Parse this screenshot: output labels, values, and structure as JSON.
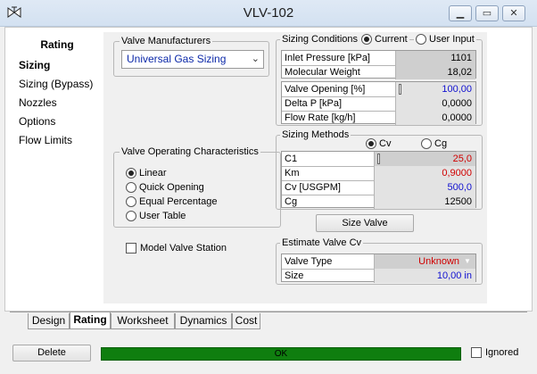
{
  "window": {
    "title": "VLV-102",
    "minimize_glyph": "▁",
    "restore_glyph": "▭",
    "close_glyph": "✕"
  },
  "nav": {
    "heading": "Rating",
    "items": [
      {
        "label": "Sizing"
      },
      {
        "label": "Sizing (Bypass)"
      },
      {
        "label": "Nozzles"
      },
      {
        "label": "Options"
      },
      {
        "label": "Flow Limits"
      }
    ],
    "selected": "Sizing"
  },
  "valve_manufacturers": {
    "title": "Valve Manufacturers",
    "selected": "Universal Gas Sizing",
    "chevron": "⌄"
  },
  "operating_characteristics": {
    "title": "Valve Operating Characteristics",
    "options": [
      {
        "label": "Linear",
        "selected": true
      },
      {
        "label": "Quick Opening",
        "selected": false
      },
      {
        "label": "Equal Percentage",
        "selected": false
      },
      {
        "label": "User Table",
        "selected": false
      }
    ]
  },
  "model_valve_station": {
    "label": "Model Valve Station",
    "checked": false
  },
  "sizing_conditions": {
    "title": "Sizing Conditions",
    "current_label": "Current",
    "user_input_label": "User Input",
    "selected": "Current",
    "rows_top": [
      {
        "label": "Inlet Pressure [kPa]",
        "value": "1101"
      },
      {
        "label": "Molecular Weight",
        "value": "18,02"
      }
    ],
    "rows_bottom": [
      {
        "label": "Valve Opening [%]",
        "value": "100,00"
      },
      {
        "label": "Delta P [kPa]",
        "value": "0,0000"
      },
      {
        "label": "Flow Rate [kg/h]",
        "value": "0,0000"
      }
    ]
  },
  "sizing_methods": {
    "title": "Sizing Methods",
    "cv_label": "Cv",
    "cg_label": "Cg",
    "selected": "Cv",
    "rows": [
      {
        "label": "C1",
        "value": "25,0"
      },
      {
        "label": "Km",
        "value": "0,9000"
      },
      {
        "label": "Cv [USGPM]",
        "value": "500,0"
      },
      {
        "label": "Cg",
        "value": "12500"
      }
    ]
  },
  "size_valve_button": "Size Valve",
  "estimate_valve_cv": {
    "title": "Estimate Valve Cv",
    "rows": [
      {
        "label": "Valve Type",
        "value": "Unknown"
      },
      {
        "label": "Size",
        "value": "10,00 in"
      }
    ]
  },
  "tabs": [
    {
      "label": "Design",
      "active": false
    },
    {
      "label": "Rating",
      "active": true
    },
    {
      "label": "Worksheet",
      "active": false
    },
    {
      "label": "Dynamics",
      "active": false
    },
    {
      "label": "Cost",
      "active": false
    }
  ],
  "footer": {
    "delete_label": "Delete",
    "status_text": "OK",
    "ignored_label": "Ignored",
    "ignored_checked": false
  },
  "colors": {
    "status_ok": "#0f7e0f",
    "value_red": "#d00000",
    "value_blue": "#1010d0",
    "link_blue": "#0b28a8"
  }
}
